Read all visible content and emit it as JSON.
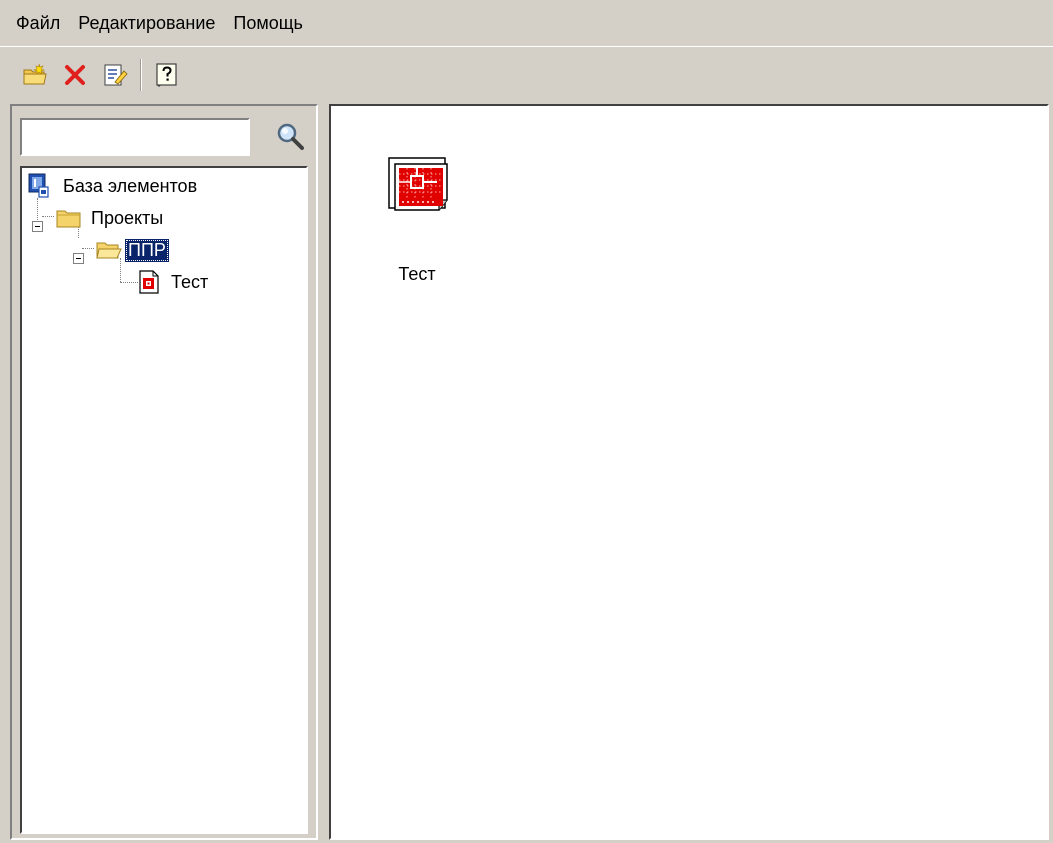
{
  "menu": {
    "items": [
      "Файл",
      "Редактирование",
      "Помощь"
    ]
  },
  "toolbar": {
    "buttons": [
      "new-folder-icon",
      "delete-icon",
      "edit-properties-icon",
      "help-icon"
    ]
  },
  "search": {
    "value": "",
    "placeholder": ""
  },
  "tree": {
    "root_label": "База элементов",
    "projects_label": "Проекты",
    "ppr_label": "ППР",
    "test_label": "Тест",
    "selected": "ППР"
  },
  "content": {
    "items": [
      {
        "label": "Тест",
        "icon": "drawing-document-icon"
      }
    ]
  },
  "colors": {
    "selection": "#0a246a",
    "window_bg": "#d4d0c8",
    "delete_red": "#e0201c",
    "doc_red": "#e00000"
  }
}
